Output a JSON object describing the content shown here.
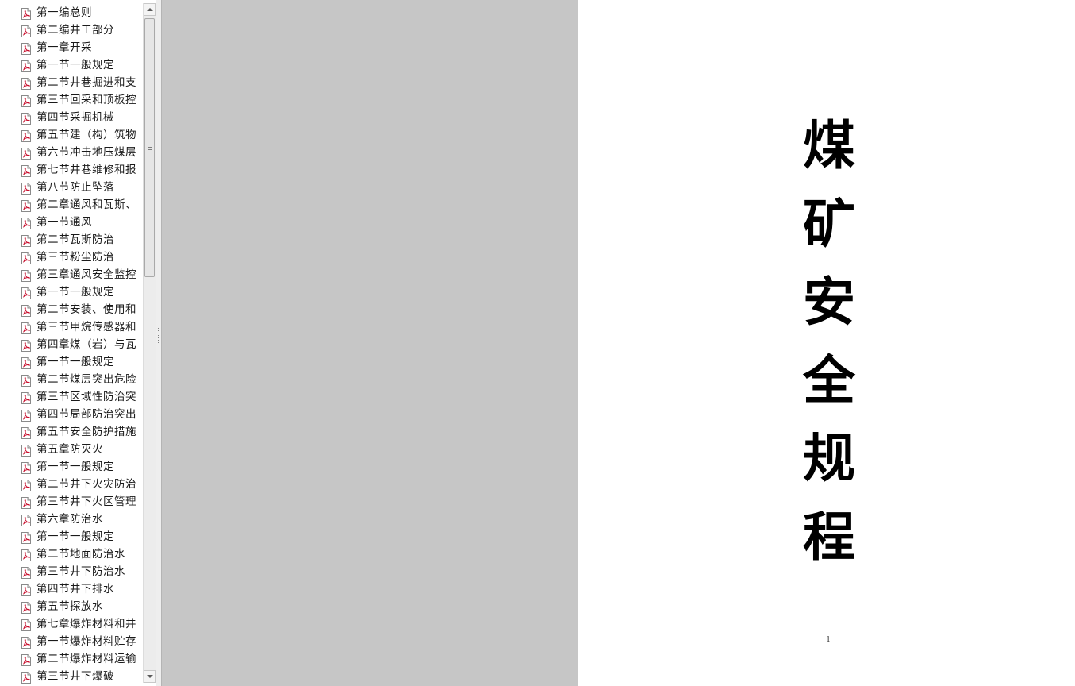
{
  "bookmarks": {
    "items": [
      {
        "label": "第一编总则"
      },
      {
        "label": "第二编井工部分"
      },
      {
        "label": "第一章开采"
      },
      {
        "label": "第一节一般规定"
      },
      {
        "label": "第二节井巷掘进和支"
      },
      {
        "label": "第三节回采和顶板控"
      },
      {
        "label": "第四节采掘机械"
      },
      {
        "label": "第五节建（构）筑物"
      },
      {
        "label": "第六节冲击地压煤层"
      },
      {
        "label": "第七节井巷维修和报"
      },
      {
        "label": "第八节防止坠落"
      },
      {
        "label": "第二章通风和瓦斯、"
      },
      {
        "label": "第一节通风"
      },
      {
        "label": "第二节瓦斯防治"
      },
      {
        "label": "第三节粉尘防治"
      },
      {
        "label": "第三章通风安全监控"
      },
      {
        "label": "第一节一般规定"
      },
      {
        "label": "第二节安装、使用和"
      },
      {
        "label": "第三节甲烷传感器和"
      },
      {
        "label": "第四章煤（岩）与瓦"
      },
      {
        "label": "第一节一般规定"
      },
      {
        "label": "第二节煤层突出危险"
      },
      {
        "label": "第三节区域性防治突"
      },
      {
        "label": "第四节局部防治突出"
      },
      {
        "label": "第五节安全防护措施"
      },
      {
        "label": "第五章防灭火"
      },
      {
        "label": "第一节一般规定"
      },
      {
        "label": "第二节井下火灾防治"
      },
      {
        "label": "第三节井下火区管理"
      },
      {
        "label": "第六章防治水"
      },
      {
        "label": "第一节一般规定"
      },
      {
        "label": "第二节地面防治水"
      },
      {
        "label": "第三节井下防治水"
      },
      {
        "label": "第四节井下排水"
      },
      {
        "label": "第五节探放水"
      },
      {
        "label": "第七章爆炸材料和井"
      },
      {
        "label": "第一节爆炸材料贮存"
      },
      {
        "label": "第二节爆炸材料运输"
      },
      {
        "label": "第三节井下爆破"
      }
    ],
    "item_icon": "pdf-bookmark-icon",
    "scroll_position": 0.0
  },
  "document": {
    "title_chars": [
      "煤",
      "矿",
      "安",
      "全",
      "规",
      "程"
    ],
    "page_number": "1"
  },
  "colors": {
    "viewport_background": "#c6c6c6",
    "page_background": "#ffffff",
    "icon_accent": "#c8102e"
  }
}
